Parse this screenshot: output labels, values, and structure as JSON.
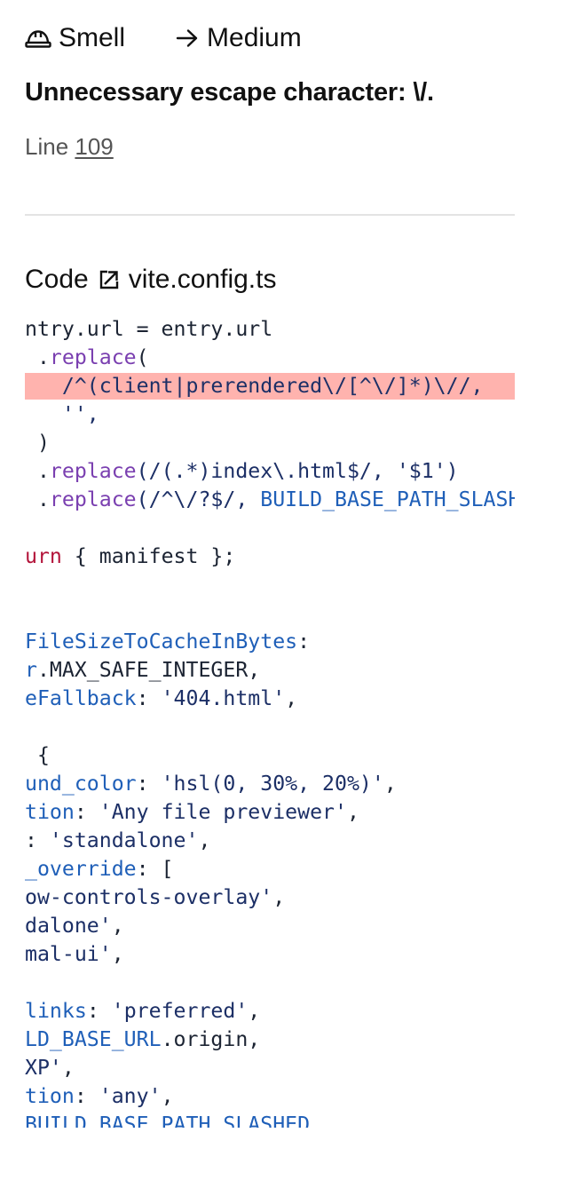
{
  "header": {
    "type_icon": "hard-hat-icon",
    "type_label": "Smell",
    "severity_icon": "arrow-right-icon",
    "severity_label": "Medium"
  },
  "issue": {
    "title": "Unnecessary escape character: \\/.",
    "line_prefix": "Line",
    "line_number": "109"
  },
  "code_section": {
    "heading": "Code",
    "open_icon": "external-link-icon",
    "file_name": "vite.config.ts",
    "highlighted_line_index": 2,
    "lines": [
      [
        {
          "t": "ntry.url = entry.url",
          "c": "p"
        }
      ],
      [
        {
          "t": " .",
          "c": "p"
        },
        {
          "t": "replace",
          "c": "m"
        },
        {
          "t": "(",
          "c": "p"
        }
      ],
      [
        {
          "t": "   /^(client|prerendered\\/[^\\/]*)\\//,",
          "c": "s"
        }
      ],
      [
        {
          "t": "   '',",
          "c": "s"
        }
      ],
      [
        {
          "t": " )",
          "c": "p"
        }
      ],
      [
        {
          "t": " .",
          "c": "p"
        },
        {
          "t": "replace",
          "c": "m"
        },
        {
          "t": "(/(.*)index\\.html$/, '$1')",
          "c": "s"
        }
      ],
      [
        {
          "t": " .",
          "c": "p"
        },
        {
          "t": "replace",
          "c": "m"
        },
        {
          "t": "(/^\\/?$/, ",
          "c": "s"
        },
        {
          "t": "BUILD_BASE_PATH_SLASHED",
          "c": "b"
        }
      ],
      [],
      [
        {
          "t": "urn",
          "c": "k"
        },
        {
          "t": " { manifest };",
          "c": "p"
        }
      ],
      [],
      [],
      [
        {
          "t": "FileSizeToCacheInBytes",
          "c": "b"
        },
        {
          "t": ":",
          "c": "p"
        }
      ],
      [
        {
          "t": "r",
          "c": "b"
        },
        {
          "t": ".MAX_SAFE_INTEGER,",
          "c": "p"
        }
      ],
      [
        {
          "t": "eFallback",
          "c": "b"
        },
        {
          "t": ": ",
          "c": "p"
        },
        {
          "t": "'404.html'",
          "c": "s"
        },
        {
          "t": ",",
          "c": "p"
        }
      ],
      [],
      [
        {
          "t": " {",
          "c": "p"
        }
      ],
      [
        {
          "t": "und_color",
          "c": "b"
        },
        {
          "t": ": ",
          "c": "p"
        },
        {
          "t": "'hsl(0, 30%, 20%)'",
          "c": "s"
        },
        {
          "t": ",",
          "c": "p"
        }
      ],
      [
        {
          "t": "tion",
          "c": "b"
        },
        {
          "t": ": ",
          "c": "p"
        },
        {
          "t": "'Any file previewer'",
          "c": "s"
        },
        {
          "t": ",",
          "c": "p"
        }
      ],
      [
        {
          "t": ": ",
          "c": "p"
        },
        {
          "t": "'standalone'",
          "c": "s"
        },
        {
          "t": ",",
          "c": "p"
        }
      ],
      [
        {
          "t": "_override",
          "c": "b"
        },
        {
          "t": ": [",
          "c": "p"
        }
      ],
      [
        {
          "t": "ow-controls-overlay'",
          "c": "s"
        },
        {
          "t": ",",
          "c": "p"
        }
      ],
      [
        {
          "t": "dalone'",
          "c": "s"
        },
        {
          "t": ",",
          "c": "p"
        }
      ],
      [
        {
          "t": "mal-ui'",
          "c": "s"
        },
        {
          "t": ",",
          "c": "p"
        }
      ],
      [],
      [
        {
          "t": "links",
          "c": "b"
        },
        {
          "t": ": ",
          "c": "p"
        },
        {
          "t": "'preferred'",
          "c": "s"
        },
        {
          "t": ",",
          "c": "p"
        }
      ],
      [
        {
          "t": "LD_BASE_URL",
          "c": "b"
        },
        {
          "t": ".origin,",
          "c": "p"
        }
      ],
      [
        {
          "t": "XP'",
          "c": "s"
        },
        {
          "t": ",",
          "c": "p"
        }
      ],
      [
        {
          "t": "tion",
          "c": "b"
        },
        {
          "t": ": ",
          "c": "p"
        },
        {
          "t": "'any'",
          "c": "s"
        },
        {
          "t": ",",
          "c": "p"
        }
      ],
      [
        {
          "t": "BUILD_BASE_PATH_SLASHED",
          "c": "b"
        },
        {
          "t": ",",
          "c": "p"
        }
      ]
    ]
  },
  "colors": {
    "highlight": "#ffb3ae",
    "method": "#7a3fb0",
    "string": "#1c2f66",
    "keyword": "#b3143a",
    "identifier": "#1f5fb8",
    "plain": "#1c2433"
  }
}
